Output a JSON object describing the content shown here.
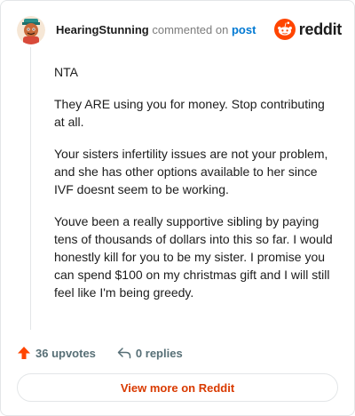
{
  "header": {
    "username": "HearingStunning",
    "verb": "commented on",
    "post_link": "post",
    "brand": "reddit",
    "avatar_icon": "snoo-avatar-icon",
    "logo_icon": "reddit-logo-icon"
  },
  "comment": {
    "paragraphs": [
      "NTA",
      "They ARE using you for money. Stop contributing at all.",
      "Your sisters infertility issues are not your problem, and she has other options available to her since IVF doesnt seem to be working.",
      "Youve been a really supportive sibling by paying tens of thousands of dollars into this so far. I would honestly kill for you to be my sister. I promise you can spend $100 on my christmas gift and I will still feel like I'm being greedy."
    ]
  },
  "actions": {
    "upvotes": "36 upvotes",
    "replies": "0 replies",
    "upvote_icon": "upvote-arrow-icon",
    "reply_icon": "reply-arrow-icon"
  },
  "footer": {
    "view_more": "View more on Reddit"
  },
  "colors": {
    "brand_orange": "#ff4500",
    "link_blue": "#0079d3",
    "view_more_text": "#d93a00"
  }
}
